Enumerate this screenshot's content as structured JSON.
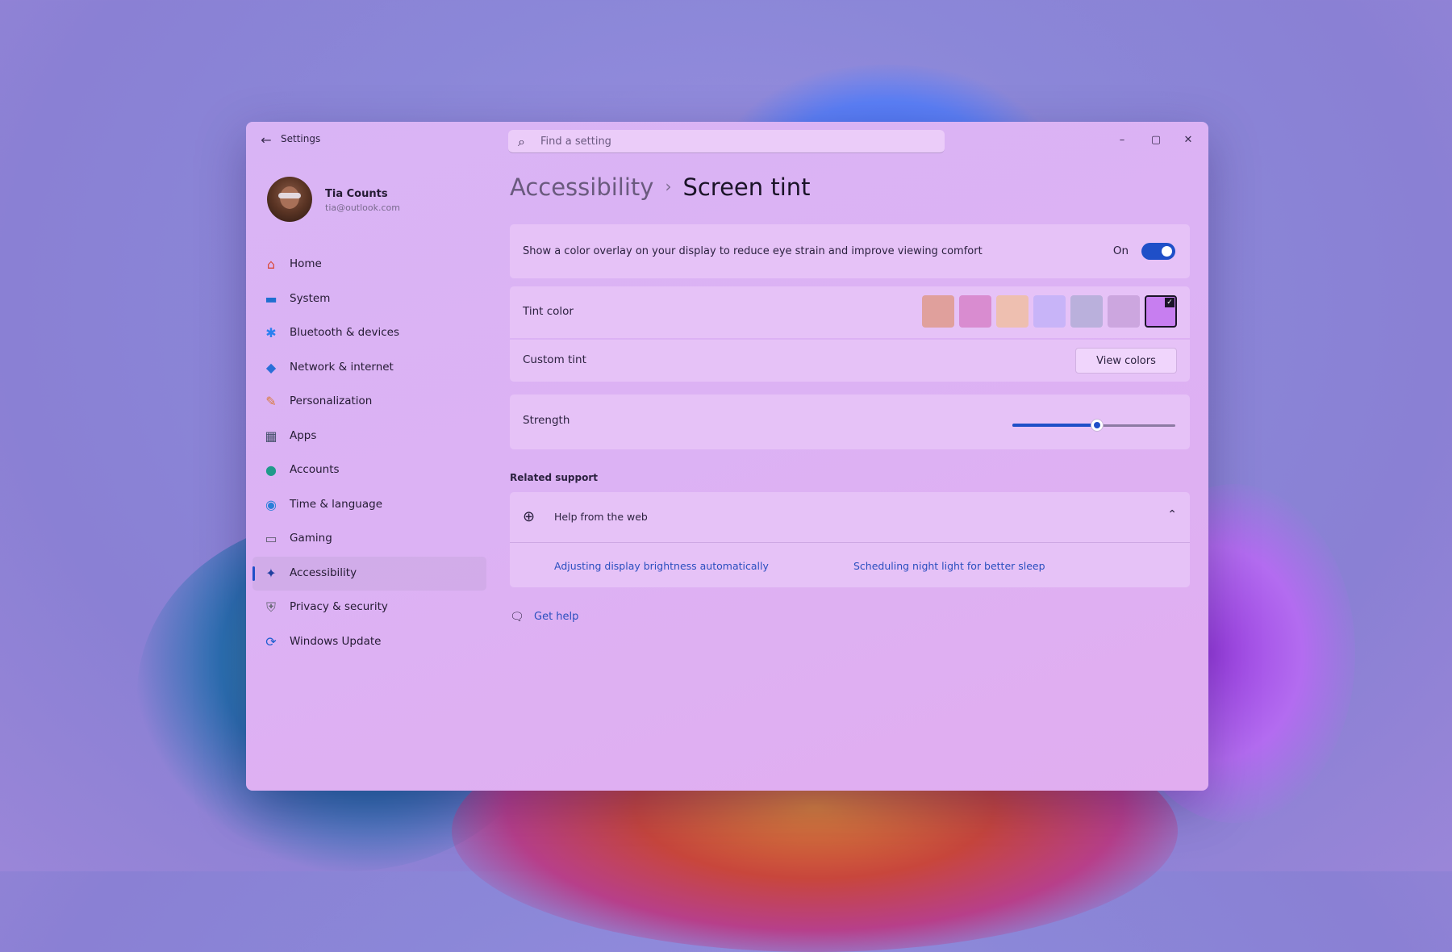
{
  "window": {
    "app_title": "Settings",
    "search": {
      "placeholder": "Find a setting",
      "value": ""
    },
    "controls": {
      "minimize": "–",
      "maximize": "▢",
      "close": "✕"
    }
  },
  "profile": {
    "name": "Tia Counts",
    "email": "tia@outlook.com"
  },
  "sidebar": {
    "items": [
      {
        "label": "Home",
        "icon": "home-icon",
        "glyph": "⌂",
        "color": "#d94a3a",
        "active": false
      },
      {
        "label": "System",
        "icon": "system-icon",
        "glyph": "▬",
        "color": "#1f6fd0",
        "active": false
      },
      {
        "label": "Bluetooth & devices",
        "icon": "bluetooth-icon",
        "glyph": "✱",
        "color": "#2a7ff0",
        "active": false
      },
      {
        "label": "Network & internet",
        "icon": "wifi-icon",
        "glyph": "◆",
        "color": "#2a6fd8",
        "active": false
      },
      {
        "label": "Personalization",
        "icon": "brush-icon",
        "glyph": "✎",
        "color": "#d97a3a",
        "active": false
      },
      {
        "label": "Apps",
        "icon": "apps-icon",
        "glyph": "▦",
        "color": "#44506a",
        "active": false
      },
      {
        "label": "Accounts",
        "icon": "accounts-icon",
        "glyph": "●",
        "color": "#1f9a8a",
        "active": false
      },
      {
        "label": "Time & language",
        "icon": "globe-clock-icon",
        "glyph": "◉",
        "color": "#2a7fd8",
        "active": false
      },
      {
        "label": "Gaming",
        "icon": "gamepad-icon",
        "glyph": "▭",
        "color": "#5a5a6a",
        "active": false
      },
      {
        "label": "Accessibility",
        "icon": "accessibility-icon",
        "glyph": "✦",
        "color": "#1f3fa0",
        "active": true
      },
      {
        "label": "Privacy & security",
        "icon": "shield-icon",
        "glyph": "⛨",
        "color": "#6a6a78",
        "active": false
      },
      {
        "label": "Windows Update",
        "icon": "update-icon",
        "glyph": "⟳",
        "color": "#1f5fd0",
        "active": false
      }
    ]
  },
  "breadcrumb": {
    "parent": "Accessibility",
    "separator": "›",
    "current": "Screen tint"
  },
  "overlay": {
    "label": "Show a color overlay on your display to reduce eye strain and improve viewing comfort",
    "state": "On",
    "enabled": true
  },
  "tint_color": {
    "label": "Tint color",
    "swatches": [
      "#e0a09c",
      "#d98cd0",
      "#eebfb0",
      "#c8b4f8",
      "#bab0dc",
      "#cca6df",
      "#c77ef0"
    ],
    "selected_index": 6
  },
  "custom_tint": {
    "label": "Custom tint",
    "button": "View colors"
  },
  "strength": {
    "label": "Strength",
    "value": 0.52
  },
  "related_support": {
    "title": "Related support",
    "help_title": "Help from the web",
    "links": [
      "Adjusting display brightness automatically",
      "Scheduling night light for better sleep"
    ]
  },
  "get_help": "Get help",
  "colors": {
    "accent": "#1f4fc8",
    "link": "#2a4fbf"
  }
}
